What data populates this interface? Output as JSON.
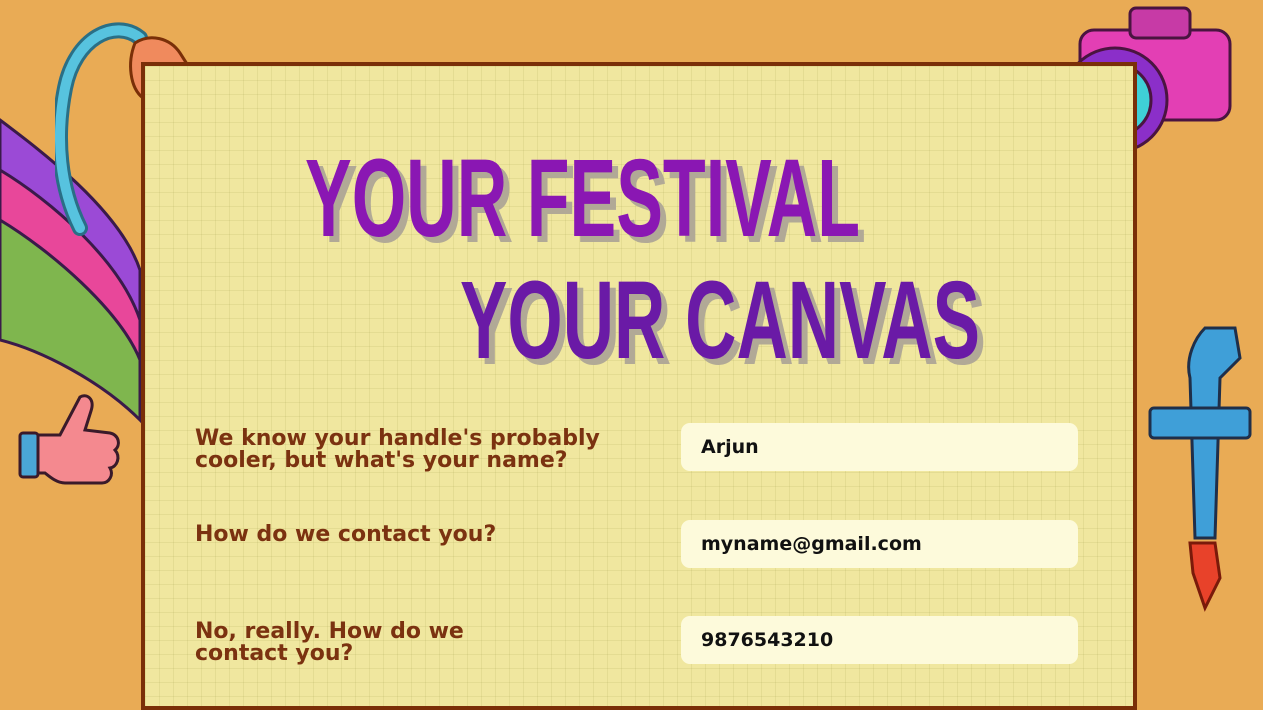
{
  "hero": {
    "line1": "YOUR FESTIVAL",
    "line2": "YOUR CANVAS"
  },
  "form": {
    "name_label": "We know your handle's probably cooler, but what's your name?",
    "name_value": "Arjun",
    "email_label": "How do we contact you?",
    "email_value": "myname@gmail.com",
    "phone_label": "No, really. How do we contact you?",
    "phone_value": "9876543210"
  },
  "colors": {
    "background": "#e9ab55",
    "card": "#f0e79f",
    "border": "#7a2f08",
    "title": "#8a17b3",
    "label": "#7b3210",
    "field": "#fdfadb"
  },
  "icons": [
    "paint-stripes-icon",
    "pointing-hand-icon",
    "thumbs-up-icon",
    "camera-icon",
    "paint-tube-rocket-icon"
  ]
}
